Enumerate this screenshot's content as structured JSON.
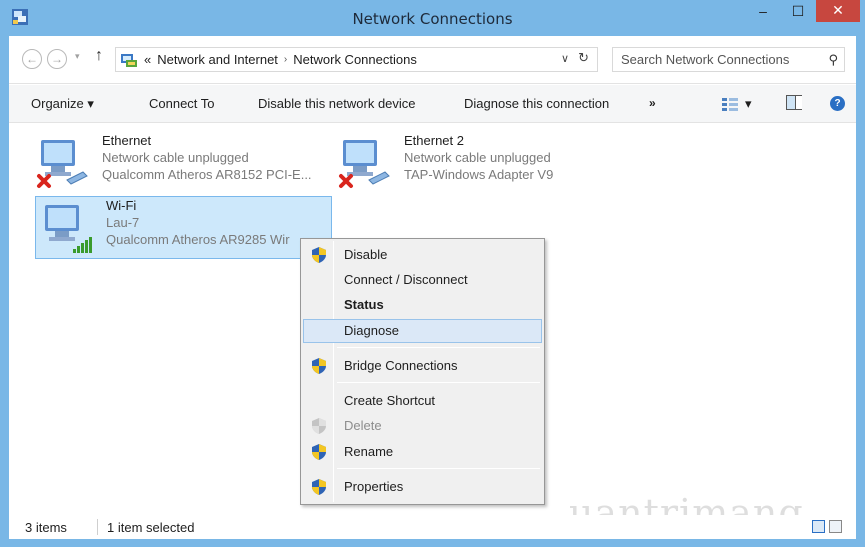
{
  "window": {
    "title": "Network Connections",
    "min_label": "–",
    "max_label": "☐",
    "close_label": "✕"
  },
  "nav": {
    "back": "←",
    "forward": "→",
    "recent": "▾",
    "up": "↑"
  },
  "address": {
    "overflow": "«",
    "crumb1": "Network and Internet",
    "separator": "›",
    "crumb2": "Network Connections",
    "dropdown": "∨",
    "refresh": "↻"
  },
  "search": {
    "placeholder": "Search Network Connections",
    "icon": "⚲"
  },
  "toolbar": {
    "organize": "Organize ▾",
    "connect_to": "Connect To",
    "disable": "Disable this network device",
    "diagnose": "Diagnose this connection",
    "more": "»",
    "view_drop": "▾",
    "help": "?"
  },
  "items": [
    {
      "name": "Ethernet",
      "status": "Network cable unplugged",
      "device": "Qualcomm Atheros AR8152 PCI-E...",
      "state": "disconnected"
    },
    {
      "name": "Ethernet 2",
      "status": "Network cable unplugged",
      "device": "TAP-Windows Adapter V9",
      "state": "disconnected"
    },
    {
      "name": "Wi-Fi",
      "status": "Lau-7",
      "device": "Qualcomm Atheros AR9285 Wir",
      "state": "connected"
    }
  ],
  "context_menu": {
    "items": [
      {
        "label": "Disable",
        "shield": true
      },
      {
        "label": "Connect / Disconnect",
        "shield": false
      },
      {
        "label": "Status",
        "shield": false,
        "bold": true
      },
      {
        "label": "Diagnose",
        "shield": false,
        "highlighted": true
      },
      {
        "label": "Bridge Connections",
        "shield": true
      },
      {
        "label": "Create Shortcut",
        "shield": false
      },
      {
        "label": "Delete",
        "shield": true,
        "disabled": true
      },
      {
        "label": "Rename",
        "shield": true
      },
      {
        "label": "Properties",
        "shield": true
      }
    ]
  },
  "statusbar": {
    "count": "3 items",
    "selection": "1 item selected"
  },
  "watermark": {
    "text": "uantrimang"
  },
  "colors": {
    "titlebar": "#79b7e6",
    "close": "#c7473f",
    "selection": "#cde8fb",
    "menu_highlight": "#dbe8f7",
    "disconnected_x": "#d9251d",
    "wifi_bars": "#3a9b2c"
  }
}
